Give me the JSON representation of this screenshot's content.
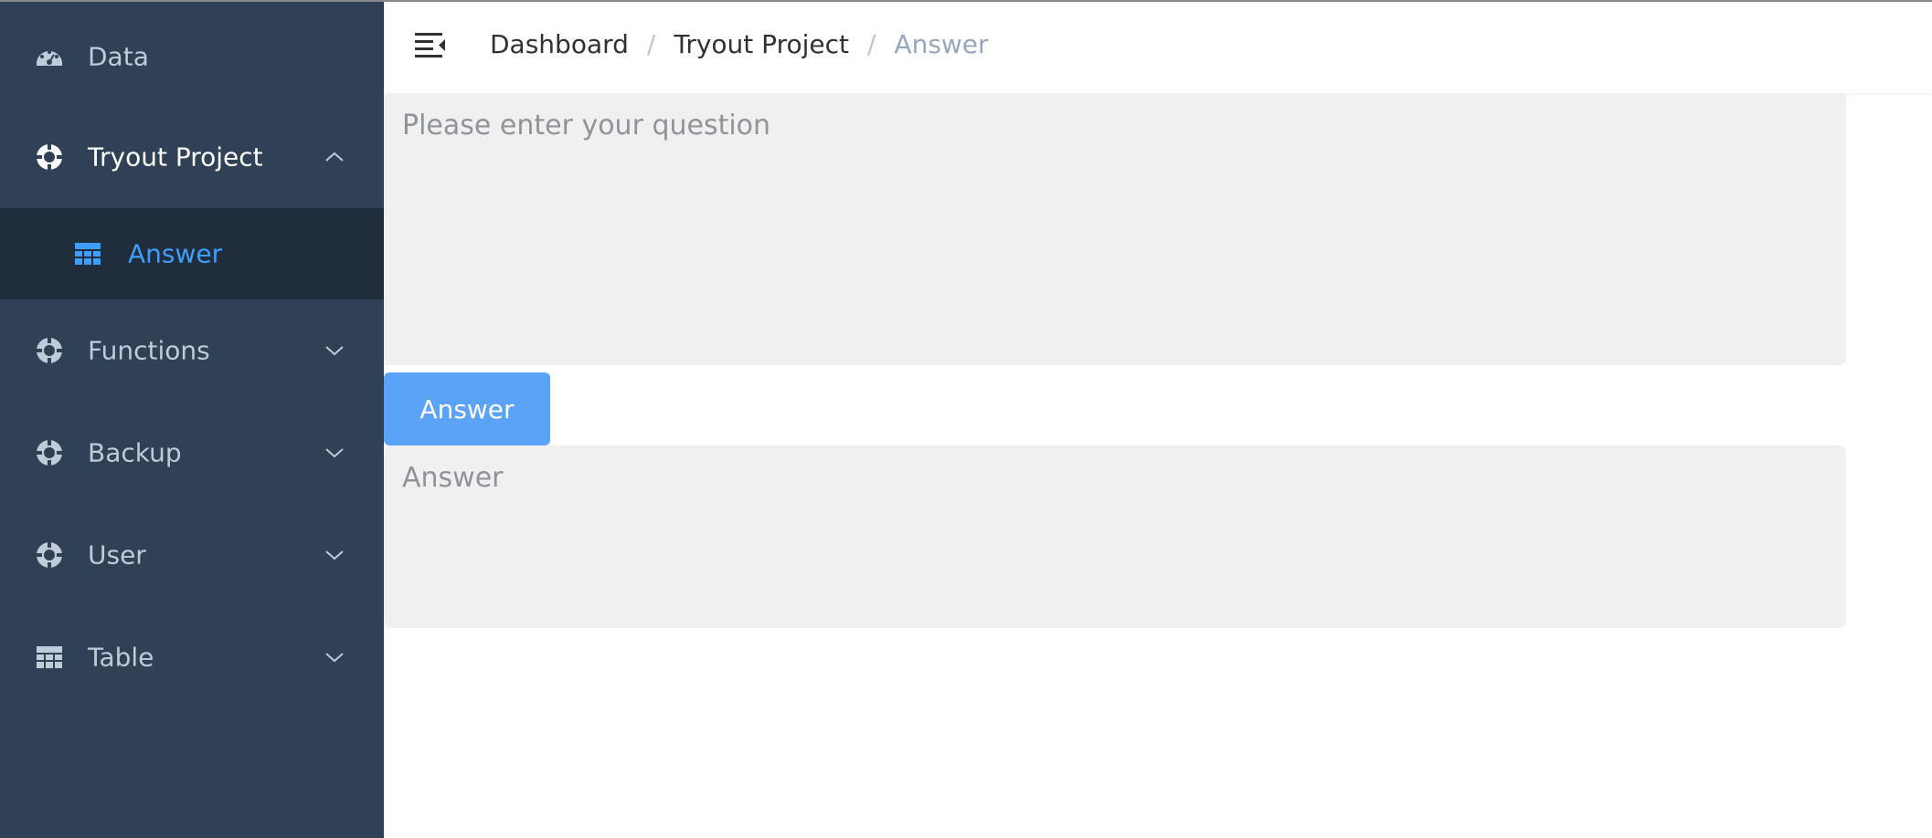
{
  "sidebar": {
    "items": [
      {
        "label": "Data",
        "icon": "dashboard-gauge-icon"
      },
      {
        "label": "Tryout Project",
        "icon": "lifebuoy-icon",
        "expanded": true
      },
      {
        "label": "Answer",
        "icon": "table-grid-icon",
        "active": true
      },
      {
        "label": "Functions",
        "icon": "lifebuoy-icon"
      },
      {
        "label": "Backup",
        "icon": "lifebuoy-icon"
      },
      {
        "label": "User",
        "icon": "lifebuoy-icon"
      },
      {
        "label": "Table",
        "icon": "table-grid-icon"
      }
    ]
  },
  "header": {
    "toggle_icon": "hamburger-icon",
    "breadcrumb": [
      "Dashboard",
      "Tryout Project",
      "Answer"
    ],
    "separator": "/"
  },
  "main": {
    "question_placeholder": "Please enter your question",
    "answer_button_label": "Answer",
    "answer_placeholder": "Answer"
  },
  "colors": {
    "sidebar_bg": "#304156",
    "submenu_bg": "#1f2d3d",
    "active_text": "#409eff",
    "button_bg": "#5ba3f7",
    "input_bg": "#f0f0f0"
  }
}
